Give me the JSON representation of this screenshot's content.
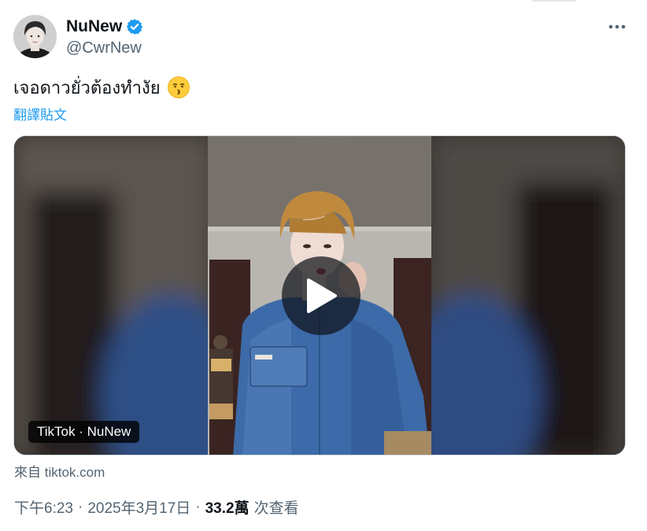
{
  "author": {
    "display_name": "NuNew",
    "handle": "@CwrNew",
    "verified": true,
    "verified_color": "#1d9bf0"
  },
  "post": {
    "text": "เจอดาวยั่วต้องทำงัย",
    "emoji_icon": "kissing-face-emoji",
    "translate_label": "翻譯貼文"
  },
  "media": {
    "type": "video",
    "source_badge": "TikTok · NuNew",
    "play_icon": "play-icon"
  },
  "source_line": "來自 tiktok.com",
  "meta": {
    "time": "下午6:23",
    "separator": "·",
    "date": "2025年3月17日",
    "views_count": "33.2萬",
    "views_label": "次查看"
  },
  "colors": {
    "text_primary": "#0f1419",
    "text_secondary": "#536471",
    "link": "#1d9bf0"
  }
}
